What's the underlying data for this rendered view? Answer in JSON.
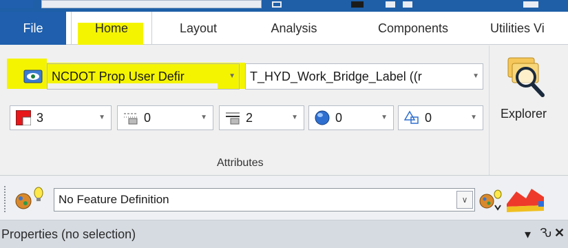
{
  "tabs": {
    "file": "File",
    "home": "Home",
    "layout": "Layout",
    "analysis": "Analysis",
    "components": "Components",
    "utilities": "Utilities Vi"
  },
  "attributes": {
    "level_combo": "NCDOT Prop User Defir",
    "element_template": "T_HYD_Work_Bridge_Label ((r",
    "color": "3",
    "line_style": "0",
    "line_weight": "2",
    "transparency": "0",
    "priority": "0",
    "group_label": "Attributes"
  },
  "explorer": {
    "label": "Explorer"
  },
  "feature": {
    "definition": "No Feature Definition"
  },
  "properties": {
    "title": "Properties (no selection)",
    "pin_icon": "Ԅ",
    "close_icon": "✕",
    "menu_icon": "▾"
  },
  "colors": {
    "file_tab": "#1f5fad",
    "highlight": "#f4f400",
    "active_color": "#e8171a"
  }
}
